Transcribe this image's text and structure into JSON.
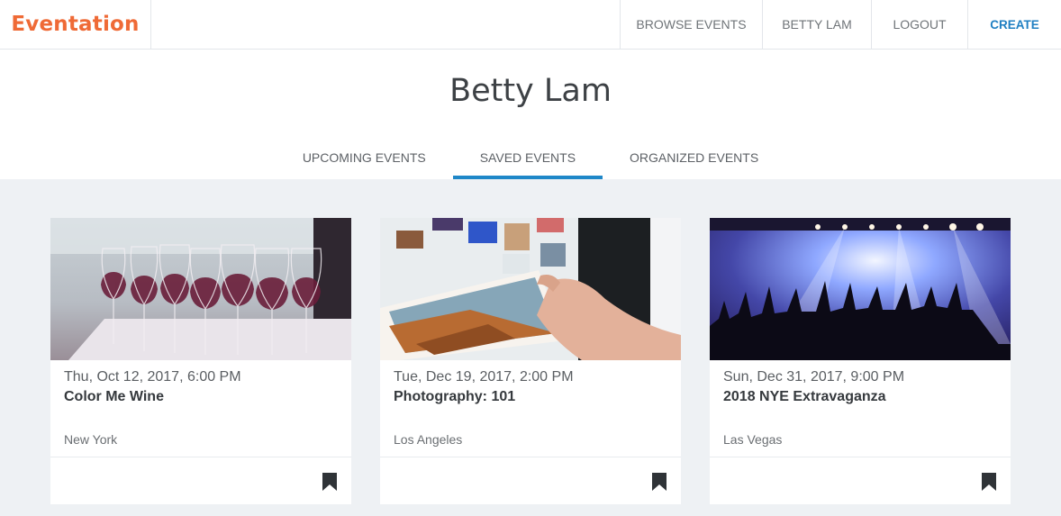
{
  "nav": {
    "brand": "Eventation",
    "links": {
      "browse": "BROWSE EVENTS",
      "user": "BETTY LAM",
      "logout": "LOGOUT",
      "create": "CREATE"
    }
  },
  "profile": {
    "name": "Betty Lam",
    "tabs": [
      "UPCOMING EVENTS",
      "SAVED EVENTS",
      "ORGANIZED EVENTS"
    ],
    "active_tab": "SAVED EVENTS"
  },
  "events": [
    {
      "date": "Thu, Oct 12, 2017, 6:00 PM",
      "title": "Color Me Wine",
      "location": "New York",
      "image": "wine-glasses-photo",
      "saved": true
    },
    {
      "date": "Tue, Dec 19, 2017, 2:00 PM",
      "title": "Photography: 101",
      "location": "Los Angeles",
      "image": "hand-holding-photo-print",
      "saved": true
    },
    {
      "date": "Sun, Dec 31, 2017, 9:00 PM",
      "title": "2018 NYE Extravaganza",
      "location": "Las Vegas",
      "image": "concert-crowd-photo",
      "saved": true
    }
  ],
  "colors": {
    "brand": "#ef6a36",
    "accent": "#1f87c8",
    "create": "#1f7fc2",
    "page_bg": "#eef1f4"
  },
  "icons": {
    "bookmark": "bookmark-icon"
  }
}
